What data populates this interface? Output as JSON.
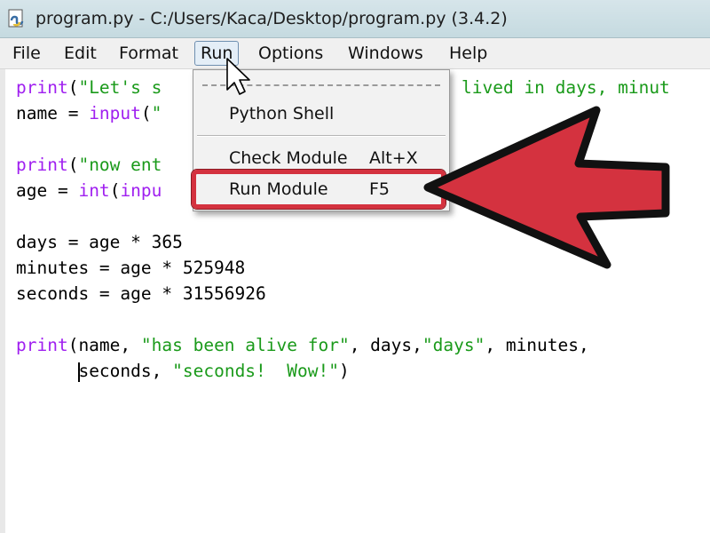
{
  "window": {
    "title": "program.py - C:/Users/Kaca/Desktop/program.py (3.4.2)",
    "icon": "python-idle-icon"
  },
  "menubar": {
    "items": [
      {
        "label": "File"
      },
      {
        "label": "Edit"
      },
      {
        "label": "Format"
      },
      {
        "label": "Run",
        "active": true
      },
      {
        "label": "Options"
      },
      {
        "label": "Windows"
      },
      {
        "label": "Help"
      }
    ]
  },
  "run_menu": {
    "items": [
      {
        "label": "Python Shell",
        "accelerator": ""
      },
      {
        "label": "Check Module",
        "accelerator": "Alt+X"
      },
      {
        "label": "Run Module",
        "accelerator": "F5",
        "highlighted": true
      }
    ]
  },
  "editor": {
    "lines": [
      {
        "code": "print",
        "string_part": "(\"Let's s",
        "visible_tail": " lived in days, minut"
      },
      {
        "code": "name = input(\""
      },
      {
        "code": ""
      },
      {
        "code": "print(\"now ent"
      },
      {
        "code": "age = int(inpu"
      },
      {
        "code": ""
      },
      {
        "code": "days = age * 365"
      },
      {
        "code": "minutes = age * 525948"
      },
      {
        "code": "seconds = age * 31556926"
      },
      {
        "code": ""
      },
      {
        "code": "print(name, \"has been alive for\", days,\"days\", minutes,"
      },
      {
        "code": "      seconds, \"seconds!  Wow!\")"
      }
    ],
    "segments": {
      "l1_kw": "print",
      "l1_open": "(",
      "l1_str": "\"Let's s",
      "l1_tail": "lived in days, minut",
      "l2_pre": "name = ",
      "l2_kw": "input",
      "l2_open": "(",
      "l2_str": "\"",
      "l4_kw": "print",
      "l4_open": "(",
      "l4_str": "\"now ent",
      "l5_pre": "age = ",
      "l5_kw1": "int",
      "l5_open": "(",
      "l5_kw2": "inpu",
      "l7": "days = age * 365",
      "l8": "minutes = age * 525948",
      "l9": "seconds = age * 31556926",
      "l11_kw": "print",
      "l11_a": "(name, ",
      "l11_s1": "\"has been alive for\"",
      "l11_b": ", days,",
      "l11_s2": "\"days\"",
      "l11_c": ", minutes,",
      "l12_indent": "      ",
      "l12_a": "seconds, ",
      "l12_s": "\"seconds!  Wow!\"",
      "l12_b": ")"
    }
  },
  "colors": {
    "keyword": "#a020f0",
    "string": "#1a9a1a",
    "annotation_red": "#d4323f"
  },
  "annotation": {
    "arrow": "red-arrow-icon",
    "cursor": "mouse-pointer-icon"
  }
}
